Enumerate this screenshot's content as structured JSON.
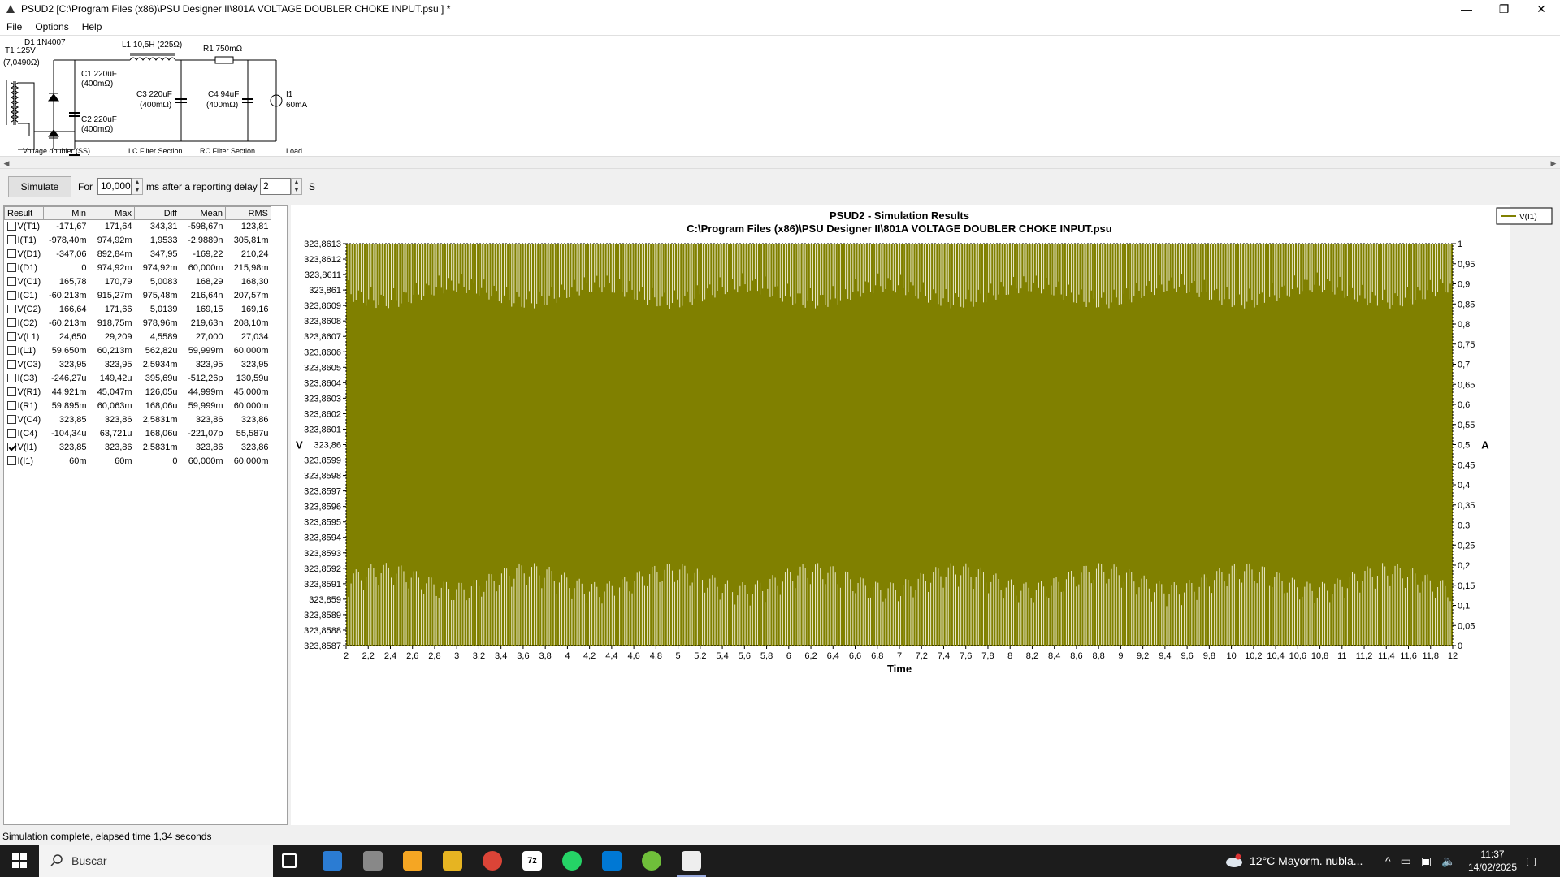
{
  "window": {
    "title": "PSUD2  [C:\\Program Files (x86)\\PSU Designer II\\801A VOLTAGE DOUBLER CHOKE INPUT.psu ] *",
    "min": "—",
    "max": "❐",
    "close": "✕"
  },
  "menu": [
    "File",
    "Options",
    "Help"
  ],
  "schematic": {
    "d1": "D1 1N4007",
    "t1": "T1 125V",
    "t1r": "(7,0490Ω)",
    "c1a": "C1 220uF",
    "c1b": "(400mΩ)",
    "c2a": "C2 220uF",
    "c2b": "(400mΩ)",
    "l1": "L1 10,5H (225Ω)",
    "c3a": "C3 220uF",
    "c3b": "(400mΩ)",
    "r1": "R1 750mΩ",
    "c4a": "C4 94uF",
    "c4b": "(400mΩ)",
    "i1a": "I1",
    "i1b": "60mA",
    "sec1": "Voltage doubler (SS)",
    "sec2": "LC Filter Section",
    "sec3": "RC Filter Section",
    "sec4": "Load"
  },
  "controls": {
    "simulate": "Simulate",
    "for": "For",
    "duration": "10,000",
    "ms": "ms",
    "after": "after a reporting delay of",
    "delay": "2",
    "s": "S"
  },
  "results": {
    "headers": [
      "Result",
      "Min",
      "Max",
      "Diff",
      "Mean",
      "RMS"
    ],
    "rows": [
      {
        "checked": false,
        "name": "V(T1)",
        "min": "-171,67",
        "max": "171,64",
        "diff": "343,31",
        "mean": "-598,67n",
        "rms": "123,81"
      },
      {
        "checked": false,
        "name": "I(T1)",
        "min": "-978,40m",
        "max": "974,92m",
        "diff": "1,9533",
        "mean": "-2,9889n",
        "rms": "305,81m"
      },
      {
        "checked": false,
        "name": "V(D1)",
        "min": "-347,06",
        "max": "892,84m",
        "diff": "347,95",
        "mean": "-169,22",
        "rms": "210,24"
      },
      {
        "checked": false,
        "name": "I(D1)",
        "min": "0",
        "max": "974,92m",
        "diff": "974,92m",
        "mean": "60,000m",
        "rms": "215,98m"
      },
      {
        "checked": false,
        "name": "V(C1)",
        "min": "165,78",
        "max": "170,79",
        "diff": "5,0083",
        "mean": "168,29",
        "rms": "168,30"
      },
      {
        "checked": false,
        "name": "I(C1)",
        "min": "-60,213m",
        "max": "915,27m",
        "diff": "975,48m",
        "mean": "216,64n",
        "rms": "207,57m"
      },
      {
        "checked": false,
        "name": "V(C2)",
        "min": "166,64",
        "max": "171,66",
        "diff": "5,0139",
        "mean": "169,15",
        "rms": "169,16"
      },
      {
        "checked": false,
        "name": "I(C2)",
        "min": "-60,213m",
        "max": "918,75m",
        "diff": "978,96m",
        "mean": "219,63n",
        "rms": "208,10m"
      },
      {
        "checked": false,
        "name": "V(L1)",
        "min": "24,650",
        "max": "29,209",
        "diff": "4,5589",
        "mean": "27,000",
        "rms": "27,034"
      },
      {
        "checked": false,
        "name": "I(L1)",
        "min": "59,650m",
        "max": "60,213m",
        "diff": "562,82u",
        "mean": "59,999m",
        "rms": "60,000m"
      },
      {
        "checked": false,
        "name": "V(C3)",
        "min": "323,95",
        "max": "323,95",
        "diff": "2,5934m",
        "mean": "323,95",
        "rms": "323,95"
      },
      {
        "checked": false,
        "name": "I(C3)",
        "min": "-246,27u",
        "max": "149,42u",
        "diff": "395,69u",
        "mean": "-512,26p",
        "rms": "130,59u"
      },
      {
        "checked": false,
        "name": "V(R1)",
        "min": "44,921m",
        "max": "45,047m",
        "diff": "126,05u",
        "mean": "44,999m",
        "rms": "45,000m"
      },
      {
        "checked": false,
        "name": "I(R1)",
        "min": "59,895m",
        "max": "60,063m",
        "diff": "168,06u",
        "mean": "59,999m",
        "rms": "60,000m"
      },
      {
        "checked": false,
        "name": "V(C4)",
        "min": "323,85",
        "max": "323,86",
        "diff": "2,5831m",
        "mean": "323,86",
        "rms": "323,86"
      },
      {
        "checked": false,
        "name": "I(C4)",
        "min": "-104,34u",
        "max": "63,721u",
        "diff": "168,06u",
        "mean": "-221,07p",
        "rms": "55,587u"
      },
      {
        "checked": true,
        "name": "V(I1)",
        "min": "323,85",
        "max": "323,86",
        "diff": "2,5831m",
        "mean": "323,86",
        "rms": "323,86"
      },
      {
        "checked": false,
        "name": "I(I1)",
        "min": "60m",
        "max": "60m",
        "diff": "0",
        "mean": "60,000m",
        "rms": "60,000m"
      }
    ]
  },
  "chart_data": {
    "type": "line",
    "title": "PSUD2 - Simulation Results",
    "subtitle": "C:\\Program Files (x86)\\PSU Designer II\\801A VOLTAGE DOUBLER CHOKE INPUT.psu",
    "xlabel": "Time",
    "ylabel": "V",
    "y2label": "A",
    "xlim": [
      2,
      12
    ],
    "ylim": [
      323.8587,
      323.8613
    ],
    "y2lim": [
      0,
      1
    ],
    "x_ticks": [
      "2",
      "2,2",
      "2,4",
      "2,6",
      "2,8",
      "3",
      "3,2",
      "3,4",
      "3,6",
      "3,8",
      "4",
      "4,2",
      "4,4",
      "4,6",
      "4,8",
      "5",
      "5,2",
      "5,4",
      "5,6",
      "5,8",
      "6",
      "6,2",
      "6,4",
      "6,6",
      "6,8",
      "7",
      "7,2",
      "7,4",
      "7,6",
      "7,8",
      "8",
      "8,2",
      "8,4",
      "8,6",
      "8,8",
      "9",
      "9,2",
      "9,4",
      "9,6",
      "9,8",
      "10",
      "10,2",
      "10,4",
      "10,6",
      "10,8",
      "11",
      "11,2",
      "11,4",
      "11,6",
      "11,8",
      "12"
    ],
    "y_ticks": [
      "323,8613",
      "323,8612",
      "323,8611",
      "323,861",
      "323,8609",
      "323,8608",
      "323,8607",
      "323,8606",
      "323,8605",
      "323,8604",
      "323,8603",
      "323,8602",
      "323,8601",
      "323,86",
      "323,8599",
      "323,8598",
      "323,8597",
      "323,8596",
      "323,8595",
      "323,8594",
      "323,8593",
      "323,8592",
      "323,8591",
      "323,859",
      "323,8589",
      "323,8588",
      "323,8587"
    ],
    "y2_ticks": [
      "1",
      "0,95",
      "0,9",
      "0,85",
      "0,8",
      "0,75",
      "0,7",
      "0,65",
      "0,6",
      "0,55",
      "0,5",
      "0,45",
      "0,4",
      "0,35",
      "0,3",
      "0,25",
      "0,2",
      "0,15",
      "0,1",
      "0,05",
      "0"
    ],
    "legend": "top-right",
    "series": [
      {
        "name": "V(I1)",
        "color": "#808000",
        "ripple_band": [
          323.8587,
          323.8613
        ]
      }
    ],
    "plot_color": "#808000"
  },
  "status": "Simulation complete, elapsed time 1,34 seconds",
  "taskbar": {
    "search": "Buscar",
    "weather": "12°C  Mayorm. nubla...",
    "time": "11:37",
    "date": "14/02/2025"
  }
}
